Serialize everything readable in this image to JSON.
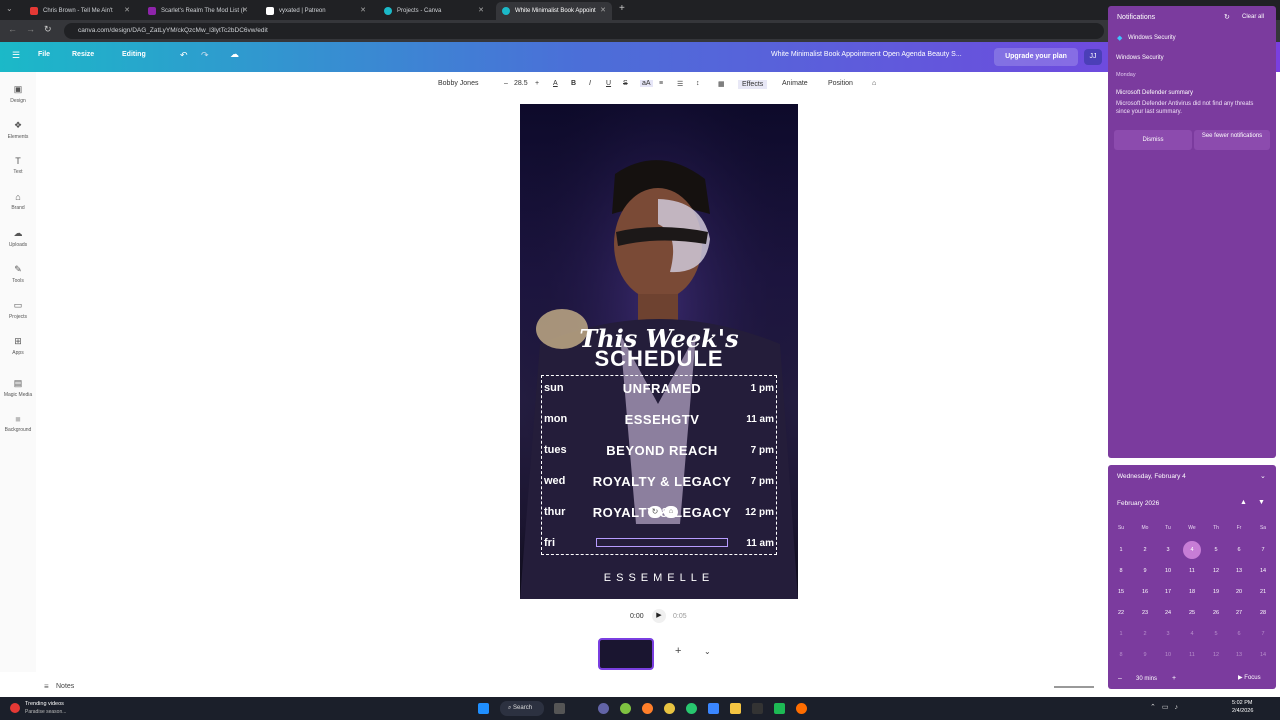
{
  "tabs": [
    {
      "label": "Chris Brown - Tell Me Ain't",
      "color": "#e53935"
    },
    {
      "label": "Scarlet's Realm The Mod List (I",
      "color": "#8e24aa"
    },
    {
      "label": "vyxated | Patreon",
      "color": "#111111"
    },
    {
      "label": "Projects - Canva",
      "color": "#1bb9c8"
    },
    {
      "label": "White Minimalist Book Appoint",
      "color": "#1bb9c8"
    }
  ],
  "address": {
    "url": "canva.com/design/DAG_ZatLyYM/ckQzcMw_l3lytTc2bDC6vw/edit"
  },
  "header": {
    "file": "File",
    "resize": "Resize",
    "editing": "Editing",
    "doc_title": "White Minimalist Book Appointment Open Agenda Beauty S...",
    "upgrade": "Upgrade your plan",
    "avatar": "JJ"
  },
  "sidebar": [
    {
      "icon": "design-icon",
      "label": "Design"
    },
    {
      "icon": "elements-icon",
      "label": "Elements"
    },
    {
      "icon": "text-icon",
      "label": "Text"
    },
    {
      "icon": "brand-icon",
      "label": "Brand"
    },
    {
      "icon": "uploads-icon",
      "label": "Uploads"
    },
    {
      "icon": "tools-icon",
      "label": "Tools"
    },
    {
      "icon": "projects-icon",
      "label": "Projects"
    },
    {
      "icon": "apps-icon",
      "label": "Apps"
    },
    {
      "icon": "magic-media-icon",
      "label": "Magic Media"
    },
    {
      "icon": "background-icon",
      "label": "Background"
    }
  ],
  "toolbar": {
    "font": "Bobby Jones",
    "size": "28.5",
    "effects": "Effects",
    "animate": "Animate",
    "position": "Position"
  },
  "design": {
    "title_script": "This Week's",
    "title_bold": "SCHEDULE",
    "rows": [
      {
        "day": "sun",
        "name": "UNFRAMED",
        "time": "1 pm"
      },
      {
        "day": "mon",
        "name": "ESSEHGTV",
        "time": "11 am"
      },
      {
        "day": "tues",
        "name": "BEYOND REACH",
        "time": "7 pm"
      },
      {
        "day": "wed",
        "name": "ROYALTY & LEGACY",
        "time": "7 pm"
      },
      {
        "day": "thur",
        "name": "ROYALTY & LEGACY",
        "time": "12 pm"
      },
      {
        "day": "fri",
        "name": "",
        "time": "11 am"
      }
    ],
    "footer": "ESSEMELLE"
  },
  "playback": {
    "current": "0:00",
    "duration": "0:05"
  },
  "notes_label": "Notes",
  "notifications": {
    "title": "Notifications",
    "clear_all": "Clear all",
    "app": "Windows Security",
    "group_app": "Windows Security",
    "day": "Monday",
    "summary_title": "Microsoft Defender summary",
    "summary_body": "Microsoft Defender Antivirus did not find any threats since your last summary.",
    "dismiss": "Dismiss",
    "see_fewer": "See fewer notifications"
  },
  "calendar": {
    "date_header": "Wednesday, February 4",
    "month": "February 2026",
    "weekdays": [
      "Su",
      "Mo",
      "Tu",
      "We",
      "Th",
      "Fr",
      "Sa"
    ],
    "weeks": [
      [
        "1",
        "2",
        "3",
        "4",
        "5",
        "6",
        "7"
      ],
      [
        "8",
        "9",
        "10",
        "11",
        "12",
        "13",
        "14"
      ],
      [
        "15",
        "16",
        "17",
        "18",
        "19",
        "20",
        "21"
      ],
      [
        "22",
        "23",
        "24",
        "25",
        "26",
        "27",
        "28"
      ],
      [
        "1",
        "2",
        "3",
        "4",
        "5",
        "6",
        "7"
      ],
      [
        "8",
        "9",
        "10",
        "11",
        "12",
        "13",
        "14"
      ]
    ],
    "today": "4",
    "focus_minutes": "30 mins",
    "focus": "Focus"
  },
  "taskbar": {
    "news_title": "Trending videos",
    "news_sub": "Paradise season...",
    "search": "Search",
    "time": "5:02 PM",
    "date": "2/4/2026"
  },
  "colors": {
    "panel": "#7b3b9e",
    "canva_gradient_start": "#1bb9c8",
    "canva_gradient_end": "#7a3fe0",
    "today": "#c77dd6"
  }
}
